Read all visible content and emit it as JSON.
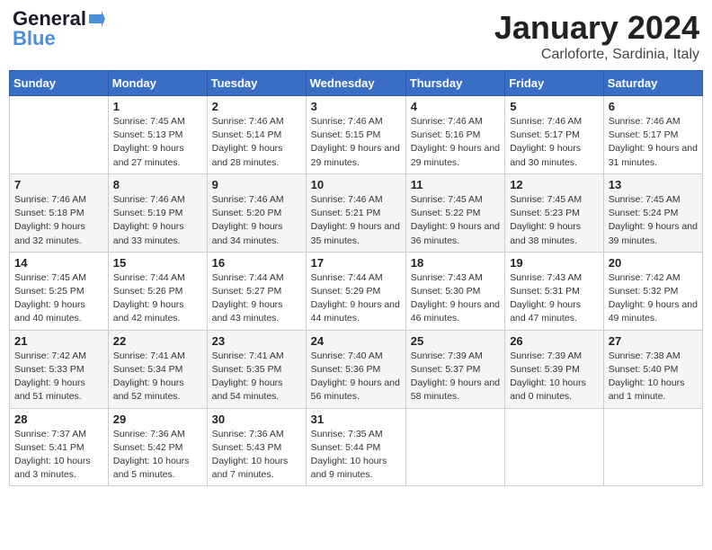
{
  "header": {
    "logo_line1": "General",
    "logo_line2": "Blue",
    "month_title": "January 2024",
    "subtitle": "Carloforte, Sardinia, Italy"
  },
  "calendar": {
    "days_of_week": [
      "Sunday",
      "Monday",
      "Tuesday",
      "Wednesday",
      "Thursday",
      "Friday",
      "Saturday"
    ],
    "weeks": [
      [
        {
          "day": "",
          "sunrise": "",
          "sunset": "",
          "daylight": ""
        },
        {
          "day": "1",
          "sunrise": "Sunrise: 7:45 AM",
          "sunset": "Sunset: 5:13 PM",
          "daylight": "Daylight: 9 hours and 27 minutes."
        },
        {
          "day": "2",
          "sunrise": "Sunrise: 7:46 AM",
          "sunset": "Sunset: 5:14 PM",
          "daylight": "Daylight: 9 hours and 28 minutes."
        },
        {
          "day": "3",
          "sunrise": "Sunrise: 7:46 AM",
          "sunset": "Sunset: 5:15 PM",
          "daylight": "Daylight: 9 hours and 29 minutes."
        },
        {
          "day": "4",
          "sunrise": "Sunrise: 7:46 AM",
          "sunset": "Sunset: 5:16 PM",
          "daylight": "Daylight: 9 hours and 29 minutes."
        },
        {
          "day": "5",
          "sunrise": "Sunrise: 7:46 AM",
          "sunset": "Sunset: 5:17 PM",
          "daylight": "Daylight: 9 hours and 30 minutes."
        },
        {
          "day": "6",
          "sunrise": "Sunrise: 7:46 AM",
          "sunset": "Sunset: 5:17 PM",
          "daylight": "Daylight: 9 hours and 31 minutes."
        }
      ],
      [
        {
          "day": "7",
          "sunrise": "Sunrise: 7:46 AM",
          "sunset": "Sunset: 5:18 PM",
          "daylight": "Daylight: 9 hours and 32 minutes."
        },
        {
          "day": "8",
          "sunrise": "Sunrise: 7:46 AM",
          "sunset": "Sunset: 5:19 PM",
          "daylight": "Daylight: 9 hours and 33 minutes."
        },
        {
          "day": "9",
          "sunrise": "Sunrise: 7:46 AM",
          "sunset": "Sunset: 5:20 PM",
          "daylight": "Daylight: 9 hours and 34 minutes."
        },
        {
          "day": "10",
          "sunrise": "Sunrise: 7:46 AM",
          "sunset": "Sunset: 5:21 PM",
          "daylight": "Daylight: 9 hours and 35 minutes."
        },
        {
          "day": "11",
          "sunrise": "Sunrise: 7:45 AM",
          "sunset": "Sunset: 5:22 PM",
          "daylight": "Daylight: 9 hours and 36 minutes."
        },
        {
          "day": "12",
          "sunrise": "Sunrise: 7:45 AM",
          "sunset": "Sunset: 5:23 PM",
          "daylight": "Daylight: 9 hours and 38 minutes."
        },
        {
          "day": "13",
          "sunrise": "Sunrise: 7:45 AM",
          "sunset": "Sunset: 5:24 PM",
          "daylight": "Daylight: 9 hours and 39 minutes."
        }
      ],
      [
        {
          "day": "14",
          "sunrise": "Sunrise: 7:45 AM",
          "sunset": "Sunset: 5:25 PM",
          "daylight": "Daylight: 9 hours and 40 minutes."
        },
        {
          "day": "15",
          "sunrise": "Sunrise: 7:44 AM",
          "sunset": "Sunset: 5:26 PM",
          "daylight": "Daylight: 9 hours and 42 minutes."
        },
        {
          "day": "16",
          "sunrise": "Sunrise: 7:44 AM",
          "sunset": "Sunset: 5:27 PM",
          "daylight": "Daylight: 9 hours and 43 minutes."
        },
        {
          "day": "17",
          "sunrise": "Sunrise: 7:44 AM",
          "sunset": "Sunset: 5:29 PM",
          "daylight": "Daylight: 9 hours and 44 minutes."
        },
        {
          "day": "18",
          "sunrise": "Sunrise: 7:43 AM",
          "sunset": "Sunset: 5:30 PM",
          "daylight": "Daylight: 9 hours and 46 minutes."
        },
        {
          "day": "19",
          "sunrise": "Sunrise: 7:43 AM",
          "sunset": "Sunset: 5:31 PM",
          "daylight": "Daylight: 9 hours and 47 minutes."
        },
        {
          "day": "20",
          "sunrise": "Sunrise: 7:42 AM",
          "sunset": "Sunset: 5:32 PM",
          "daylight": "Daylight: 9 hours and 49 minutes."
        }
      ],
      [
        {
          "day": "21",
          "sunrise": "Sunrise: 7:42 AM",
          "sunset": "Sunset: 5:33 PM",
          "daylight": "Daylight: 9 hours and 51 minutes."
        },
        {
          "day": "22",
          "sunrise": "Sunrise: 7:41 AM",
          "sunset": "Sunset: 5:34 PM",
          "daylight": "Daylight: 9 hours and 52 minutes."
        },
        {
          "day": "23",
          "sunrise": "Sunrise: 7:41 AM",
          "sunset": "Sunset: 5:35 PM",
          "daylight": "Daylight: 9 hours and 54 minutes."
        },
        {
          "day": "24",
          "sunrise": "Sunrise: 7:40 AM",
          "sunset": "Sunset: 5:36 PM",
          "daylight": "Daylight: 9 hours and 56 minutes."
        },
        {
          "day": "25",
          "sunrise": "Sunrise: 7:39 AM",
          "sunset": "Sunset: 5:37 PM",
          "daylight": "Daylight: 9 hours and 58 minutes."
        },
        {
          "day": "26",
          "sunrise": "Sunrise: 7:39 AM",
          "sunset": "Sunset: 5:39 PM",
          "daylight": "Daylight: 10 hours and 0 minutes."
        },
        {
          "day": "27",
          "sunrise": "Sunrise: 7:38 AM",
          "sunset": "Sunset: 5:40 PM",
          "daylight": "Daylight: 10 hours and 1 minute."
        }
      ],
      [
        {
          "day": "28",
          "sunrise": "Sunrise: 7:37 AM",
          "sunset": "Sunset: 5:41 PM",
          "daylight": "Daylight: 10 hours and 3 minutes."
        },
        {
          "day": "29",
          "sunrise": "Sunrise: 7:36 AM",
          "sunset": "Sunset: 5:42 PM",
          "daylight": "Daylight: 10 hours and 5 minutes."
        },
        {
          "day": "30",
          "sunrise": "Sunrise: 7:36 AM",
          "sunset": "Sunset: 5:43 PM",
          "daylight": "Daylight: 10 hours and 7 minutes."
        },
        {
          "day": "31",
          "sunrise": "Sunrise: 7:35 AM",
          "sunset": "Sunset: 5:44 PM",
          "daylight": "Daylight: 10 hours and 9 minutes."
        },
        {
          "day": "",
          "sunrise": "",
          "sunset": "",
          "daylight": ""
        },
        {
          "day": "",
          "sunrise": "",
          "sunset": "",
          "daylight": ""
        },
        {
          "day": "",
          "sunrise": "",
          "sunset": "",
          "daylight": ""
        }
      ]
    ]
  }
}
